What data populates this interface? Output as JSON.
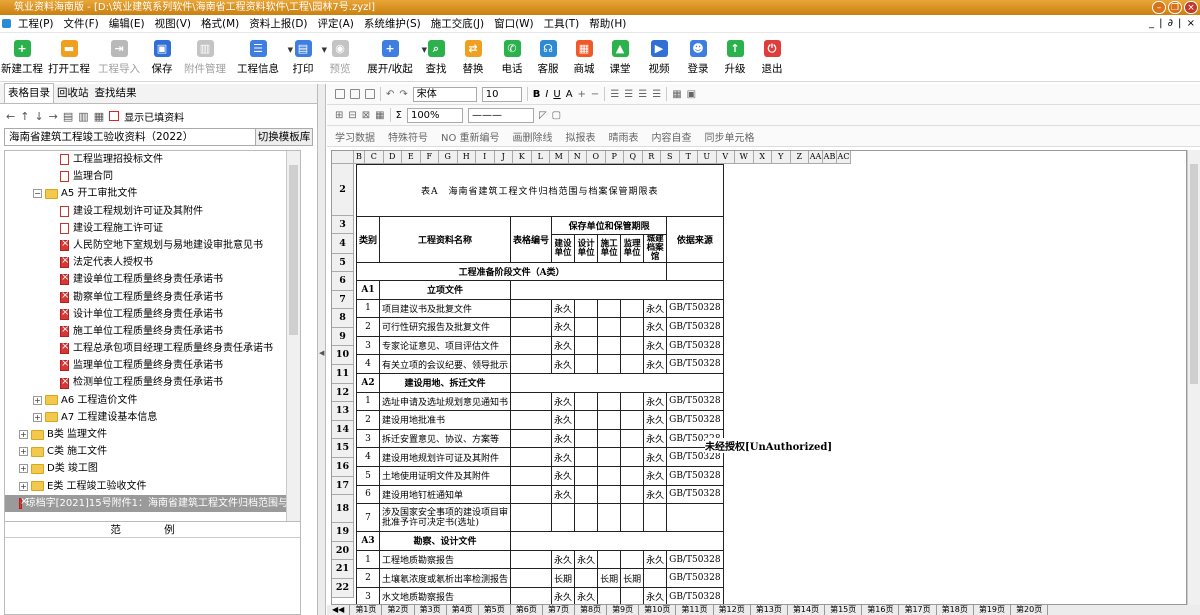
{
  "window": {
    "title": "筑业资料海南版 - [D:\\筑业建筑系列软件\\海南省工程资料软件\\工程\\园林7号.zyzl]"
  },
  "menu": [
    "工程(P)",
    "文件(F)",
    "编辑(E)",
    "视图(V)",
    "格式(M)",
    "资料上报(D)",
    "评定(A)",
    "系统维护(S)",
    "施工交底(J)",
    "窗口(W)",
    "工具(T)",
    "帮助(H)"
  ],
  "menu_mdi": "_ | ∂ | ×",
  "toolbar": [
    {
      "label": "新建工程",
      "icon": "new-project-icon",
      "color": "#2bb24c",
      "glyph": "+",
      "disabled": false,
      "w": 44
    },
    {
      "label": "打开工程",
      "icon": "open-project-icon",
      "color": "#f0a020",
      "glyph": "▬",
      "disabled": false,
      "w": 50
    },
    {
      "label": "工程导入",
      "icon": "import-icon",
      "color": "#b9b9b9",
      "glyph": "⇥",
      "disabled": true,
      "w": 50
    },
    {
      "label": "保存",
      "icon": "save-icon",
      "color": "#2f6fd6",
      "glyph": "▣",
      "disabled": false,
      "w": 36
    },
    {
      "label": "附件管理",
      "icon": "attachment-icon",
      "color": "#c4c4c4",
      "glyph": "▥",
      "disabled": true,
      "w": 50
    },
    {
      "label": "工程信息",
      "icon": "project-info-icon",
      "color": "#3d7ee0",
      "glyph": "☰",
      "disabled": false,
      "w": 56,
      "dd": true
    },
    {
      "label": "打印",
      "icon": "print-icon",
      "color": "#3d7ee0",
      "glyph": "▤",
      "disabled": false,
      "w": 34,
      "dd": true
    },
    {
      "label": "预览",
      "icon": "preview-icon",
      "color": "#c4c4c4",
      "glyph": "◉",
      "disabled": true,
      "w": 40
    },
    {
      "label": "展开/收起",
      "icon": "expand-icon",
      "color": "#3d7ee0",
      "glyph": "+",
      "disabled": false,
      "w": 60,
      "dd": true
    },
    {
      "label": "查找",
      "icon": "search-icon",
      "color": "#2bb24c",
      "glyph": "⌕",
      "disabled": false,
      "w": 32
    },
    {
      "label": "替换",
      "icon": "replace-icon",
      "color": "#f0a020",
      "glyph": "⇄",
      "disabled": false,
      "w": 42
    },
    {
      "label": "电话",
      "icon": "phone-icon",
      "color": "#2bb24c",
      "glyph": "✆",
      "disabled": false,
      "w": 36
    },
    {
      "label": "客服",
      "icon": "service-icon",
      "color": "#2f8ad6",
      "glyph": "☊",
      "disabled": false,
      "w": 36
    },
    {
      "label": "商城",
      "icon": "shop-icon",
      "color": "#f05a28",
      "glyph": "▦",
      "disabled": false,
      "w": 36
    },
    {
      "label": "课堂",
      "icon": "class-icon",
      "color": "#2bb24c",
      "glyph": "▲",
      "disabled": false,
      "w": 36
    },
    {
      "label": "视频",
      "icon": "video-icon",
      "color": "#2f6fd6",
      "glyph": "▶",
      "disabled": false,
      "w": 42
    },
    {
      "label": "登录",
      "icon": "login-icon",
      "color": "#3d7ee0",
      "glyph": "☻",
      "disabled": false,
      "w": 36
    },
    {
      "label": "升级",
      "icon": "upgrade-icon",
      "color": "#2bb24c",
      "glyph": "↑",
      "disabled": false,
      "w": 38
    },
    {
      "label": "退出",
      "icon": "exit-icon",
      "color": "#e03c3c",
      "glyph": "⏻",
      "disabled": false,
      "w": 36
    }
  ],
  "left": {
    "tabs": [
      "表格目录",
      "回收站",
      "查找结果"
    ],
    "show_filled": "显示已填资料",
    "template": "海南省建筑工程竣工验收资料（2022）",
    "switch_template": "切换模板库",
    "tree": [
      {
        "t": "工程监理招投标文件",
        "lvl": 3,
        "kind": "doc"
      },
      {
        "t": "监理合同",
        "lvl": 3,
        "kind": "doc"
      },
      {
        "t": "A5 开工审批文件",
        "lvl": 2,
        "kind": "folder",
        "exp": "−"
      },
      {
        "t": "建设工程规划许可证及其附件",
        "lvl": 3,
        "kind": "doc"
      },
      {
        "t": "建设工程施工许可证",
        "lvl": 3,
        "kind": "doc"
      },
      {
        "t": "人民防空地下室规划与易地建设审批意见书",
        "lvl": 3,
        "kind": "docx"
      },
      {
        "t": "法定代表人授权书",
        "lvl": 3,
        "kind": "docx"
      },
      {
        "t": "建设单位工程质量终身责任承诺书",
        "lvl": 3,
        "kind": "docx"
      },
      {
        "t": "勘察单位工程质量终身责任承诺书",
        "lvl": 3,
        "kind": "docx"
      },
      {
        "t": "设计单位工程质量终身责任承诺书",
        "lvl": 3,
        "kind": "docx"
      },
      {
        "t": "施工单位工程质量终身责任承诺书",
        "lvl": 3,
        "kind": "docx"
      },
      {
        "t": "工程总承包项目经理工程质量终身责任承诺书",
        "lvl": 3,
        "kind": "docx"
      },
      {
        "t": "监理单位工程质量终身责任承诺书",
        "lvl": 3,
        "kind": "docx"
      },
      {
        "t": "检测单位工程质量终身责任承诺书",
        "lvl": 3,
        "kind": "docx"
      },
      {
        "t": "A6 工程造价文件",
        "lvl": 2,
        "kind": "folder",
        "exp": "+"
      },
      {
        "t": "A7 工程建设基本信息",
        "lvl": 2,
        "kind": "folder",
        "exp": "+"
      },
      {
        "t": "B类 监理文件",
        "lvl": 1,
        "kind": "folder",
        "exp": "+"
      },
      {
        "t": "C类 施工文件",
        "lvl": 1,
        "kind": "folder",
        "exp": "+"
      },
      {
        "t": "D类 竣工图",
        "lvl": 1,
        "kind": "folder",
        "exp": "+"
      },
      {
        "t": "E类 工程竣工验收文件",
        "lvl": 1,
        "kind": "folder",
        "exp": "+"
      },
      {
        "t": "琼档字[2021]15号附件1：海南省建筑工程文件归档范围与",
        "lvl": 1,
        "kind": "docx",
        "sel": true
      }
    ],
    "sample_label": "范 例"
  },
  "right": {
    "font_name": "宋体",
    "font_size": "10",
    "zoom": "100%",
    "tb3": [
      "学习数据",
      "特殊符号",
      "NO 重新编号",
      "画删除线",
      "拟报表",
      "晴雨表",
      "内容自查",
      "同步单元格"
    ],
    "col_letters": [
      "B",
      "C",
      "D",
      "E",
      "F",
      "G",
      "H",
      "I",
      "J",
      "K",
      "L",
      "M",
      "N",
      "O",
      "P",
      "Q",
      "R",
      "S",
      "T",
      "U",
      "V",
      "W",
      "X",
      "Y",
      "Z",
      "AA",
      "AB",
      "AC"
    ],
    "sheet": {
      "title": "表A　海南省建筑工程文件归档范围与档案保管期限表",
      "hdr": {
        "cat": "类别",
        "name": "工程资料名称",
        "code": "表格编号",
        "group": "保存单位和保管期限",
        "units": [
          "建设单位",
          "设计单位",
          "施工单位",
          "监理单位",
          "城建档案馆"
        ],
        "source": "依据来源"
      },
      "section": "工程准备阶段文件（A类）",
      "watermark": "未经授权[UnAuthorized]",
      "rows": [
        {
          "r": "6",
          "type": "grp",
          "cat": "A1",
          "name": "立项文件"
        },
        {
          "r": "7",
          "cat": "1",
          "name": "项目建议书及批复文件",
          "jian": "永久",
          "she": "",
          "shi": "",
          "jl": "",
          "cj": "永久",
          "src": "GB/T50328"
        },
        {
          "r": "8",
          "cat": "2",
          "name": "可行性研究报告及批复文件",
          "jian": "永久",
          "she": "",
          "shi": "",
          "jl": "",
          "cj": "永久",
          "src": "GB/T50328"
        },
        {
          "r": "9",
          "cat": "3",
          "name": "专家论证意见、项目评估文件",
          "jian": "永久",
          "she": "",
          "shi": "",
          "jl": "",
          "cj": "永久",
          "src": "GB/T50328"
        },
        {
          "r": "10",
          "cat": "4",
          "name": "有关立项的会议纪要、领导批示",
          "jian": "永久",
          "she": "",
          "shi": "",
          "jl": "",
          "cj": "永久",
          "src": "GB/T50328"
        },
        {
          "r": "11",
          "type": "grp",
          "cat": "A2",
          "name": "建设用地、拆迁文件"
        },
        {
          "r": "12",
          "cat": "1",
          "name": "选址申请及选址规划意见通知书",
          "jian": "永久",
          "she": "",
          "shi": "",
          "jl": "",
          "cj": "永久",
          "src": "GB/T50328"
        },
        {
          "r": "13",
          "cat": "2",
          "name": "建设用地批准书",
          "jian": "永久",
          "she": "",
          "shi": "",
          "jl": "",
          "cj": "永久",
          "src": "GB/T50328"
        },
        {
          "r": "14",
          "cat": "3",
          "name": "拆迁安置意见、协议、方案等",
          "jian": "永久",
          "she": "",
          "shi": "",
          "jl": "",
          "cj": "永久",
          "src": "GB/T50328"
        },
        {
          "r": "15",
          "cat": "4",
          "name": "建设用地规划许可证及其附件",
          "jian": "永久",
          "she": "",
          "shi": "",
          "jl": "",
          "cj": "永久",
          "src": "GB/T50328"
        },
        {
          "r": "16",
          "cat": "5",
          "name": "土地使用证明文件及其附件",
          "jian": "永久",
          "she": "",
          "shi": "",
          "jl": "",
          "cj": "永久",
          "src": "GB/T50328"
        },
        {
          "r": "17",
          "cat": "6",
          "name": "建设用地钉桩通知单",
          "jian": "永久",
          "she": "",
          "shi": "",
          "jl": "",
          "cj": "永久",
          "src": "GB/T50328"
        },
        {
          "r": "18",
          "type": "tall",
          "cat": "7",
          "name": "涉及国家安全事项的建设项目审批准予许可决定书(选址)",
          "jian": "",
          "she": "",
          "shi": "",
          "jl": "",
          "cj": "",
          "src": ""
        },
        {
          "r": "19",
          "type": "grp",
          "cat": "A3",
          "name": "勘察、设计文件"
        },
        {
          "r": "20",
          "cat": "1",
          "name": "工程地质勘察报告",
          "jian": "永久",
          "she": "永久",
          "shi": "",
          "jl": "",
          "cj": "永久",
          "src": "GB/T50328"
        },
        {
          "r": "21",
          "cat": "2",
          "name": "土壤氡浓度或氡析出率检测报告",
          "jian": "长期",
          "she": "",
          "shi": "长期",
          "jl": "长期",
          "cj": "",
          "src": "GB/T50328"
        },
        {
          "r": "22",
          "cat": "3",
          "name": "水文地质勘察报告",
          "jian": "永久",
          "she": "永久",
          "shi": "",
          "jl": "",
          "cj": "永久",
          "src": "GB/T50328"
        }
      ]
    },
    "tabs": [
      "第1页",
      "第2页",
      "第3页",
      "第4页",
      "第5页",
      "第6页",
      "第7页",
      "第8页",
      "第9页",
      "第10页",
      "第11页",
      "第12页",
      "第13页",
      "第14页",
      "第15页",
      "第16页",
      "第17页",
      "第18页",
      "第19页",
      "第20页"
    ]
  }
}
